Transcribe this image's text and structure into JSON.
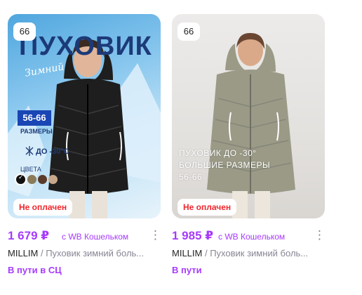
{
  "cards": [
    {
      "count": "66",
      "badge": "Не оплачен",
      "price": "1 679 ₽",
      "wallet": "с WB Кошельком",
      "more": "⋮",
      "brand": "MILLIM",
      "name": "Пуховик зимний боль...",
      "status": "В пути в СЦ",
      "art": {
        "title": "ПУХОВИК",
        "script": "Зимний",
        "size": "56-66",
        "size_label": "РАЗМЕРЫ",
        "temp": "ДО -30°С",
        "colors_label": "ЦВЕТА"
      }
    },
    {
      "count": "66",
      "badge": "Не оплачен",
      "price": "1 985 ₽",
      "wallet": "с WB Кошельком",
      "more": "⋮",
      "brand": "MILLIM",
      "name": "Пуховик зимний боль...",
      "status": "В пути",
      "art": {
        "line1": "ПУХОВИК ДО -30°",
        "line2": "БОЛЬШИЕ РАЗМЕРЫ",
        "line3": "56-66"
      }
    }
  ],
  "colors": {
    "accent": "#a73afd",
    "badge_red": "#f0272d",
    "muted": "#868695",
    "coat_black": "#1e1e1e",
    "coat_olive": "#9a9a87"
  },
  "icons": [
    "snowflake-icon",
    "check-icon",
    "more-vertical-icon"
  ]
}
